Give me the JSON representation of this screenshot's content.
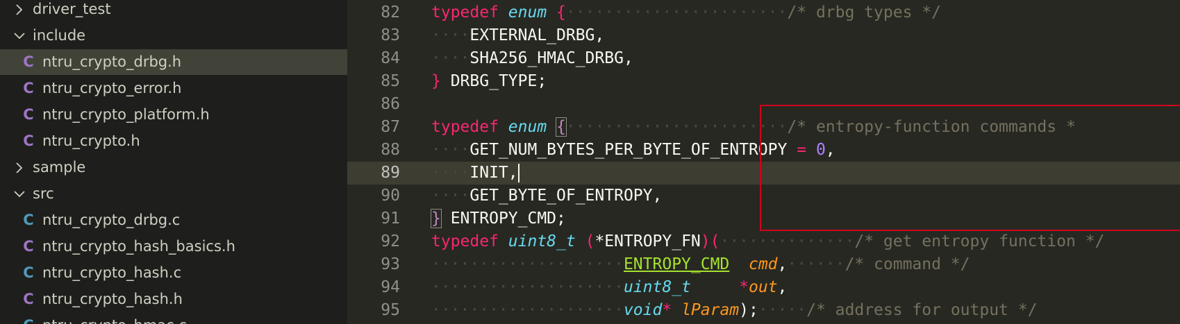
{
  "explorer": {
    "items": [
      {
        "type": "folder",
        "expanded": false,
        "label": "driver_test"
      },
      {
        "type": "folder",
        "expanded": true,
        "label": "include"
      },
      {
        "type": "file",
        "icon": "c-header-icon",
        "icon_char": "C",
        "icon_color": "#a074c4",
        "label": "ntru_crypto_drbg.h",
        "selected": true
      },
      {
        "type": "file",
        "icon": "c-header-icon",
        "icon_char": "C",
        "icon_color": "#a074c4",
        "label": "ntru_crypto_error.h"
      },
      {
        "type": "file",
        "icon": "c-header-icon",
        "icon_char": "C",
        "icon_color": "#a074c4",
        "label": "ntru_crypto_platform.h"
      },
      {
        "type": "file",
        "icon": "c-header-icon",
        "icon_char": "C",
        "icon_color": "#a074c4",
        "label": "ntru_crypto.h"
      },
      {
        "type": "folder",
        "expanded": false,
        "label": "sample"
      },
      {
        "type": "folder",
        "expanded": true,
        "label": "src"
      },
      {
        "type": "file",
        "icon": "c-source-icon",
        "icon_char": "C",
        "icon_color": "#519aba",
        "label": "ntru_crypto_drbg.c"
      },
      {
        "type": "file",
        "icon": "c-header-icon",
        "icon_char": "C",
        "icon_color": "#a074c4",
        "label": "ntru_crypto_hash_basics.h"
      },
      {
        "type": "file",
        "icon": "c-source-icon",
        "icon_char": "C",
        "icon_color": "#519aba",
        "label": "ntru_crypto_hash.c"
      },
      {
        "type": "file",
        "icon": "c-header-icon",
        "icon_char": "C",
        "icon_color": "#a074c4",
        "label": "ntru_crypto_hash.h"
      },
      {
        "type": "file",
        "icon": "c-source-icon",
        "icon_char": "C",
        "icon_color": "#519aba",
        "label": "ntru_crypto_hmac.c"
      }
    ]
  },
  "editor": {
    "current_line": "89",
    "lines": [
      {
        "num": "82",
        "tokens": [
          {
            "t": "typedef",
            "c": "kw"
          },
          {
            "t": " "
          },
          {
            "t": "enum",
            "c": "ty"
          },
          {
            "t": " "
          },
          {
            "t": "{",
            "c": "br1"
          },
          {
            "t": "·······················",
            "c": "ws"
          },
          {
            "t": "/* drbg types */",
            "c": "cm"
          }
        ]
      },
      {
        "num": "83",
        "tokens": [
          {
            "t": "····",
            "c": "ws"
          },
          {
            "t": "EXTERNAL_DRBG,"
          }
        ]
      },
      {
        "num": "84",
        "tokens": [
          {
            "t": "····",
            "c": "ws"
          },
          {
            "t": "SHA256_HMAC_DRBG,"
          }
        ]
      },
      {
        "num": "85",
        "tokens": [
          {
            "t": "}",
            "c": "br1"
          },
          {
            "t": " DRBG_TYPE;"
          }
        ]
      },
      {
        "num": "86",
        "tokens": []
      },
      {
        "num": "87",
        "tokens": [
          {
            "t": "typedef",
            "c": "kw"
          },
          {
            "t": " "
          },
          {
            "t": "enum",
            "c": "ty"
          },
          {
            "t": " "
          },
          {
            "t": "{",
            "c": "br2 bracket-box"
          },
          {
            "t": "·······················",
            "c": "ws"
          },
          {
            "t": "/* entropy-function commands *",
            "c": "cm"
          }
        ]
      },
      {
        "num": "88",
        "tokens": [
          {
            "t": "····",
            "c": "ws"
          },
          {
            "t": "GET_NUM_BYTES_PER_BYTE_OF_ENTROPY"
          },
          {
            "t": " "
          },
          {
            "t": "=",
            "c": "op"
          },
          {
            "t": " "
          },
          {
            "t": "0",
            "c": "num"
          },
          {
            "t": ","
          }
        ]
      },
      {
        "num": "89",
        "tokens": [
          {
            "t": "····",
            "c": "ws"
          },
          {
            "t": "INIT,"
          },
          {
            "t": "",
            "c": "cursor"
          }
        ]
      },
      {
        "num": "90",
        "tokens": [
          {
            "t": "····",
            "c": "ws"
          },
          {
            "t": "GET_BYTE_OF_ENTROPY,"
          }
        ]
      },
      {
        "num": "91",
        "tokens": [
          {
            "t": "}",
            "c": "br2 bracket-box"
          },
          {
            "t": " ENTROPY_CMD;"
          }
        ]
      },
      {
        "num": "92",
        "tokens": [
          {
            "t": "typedef",
            "c": "kw"
          },
          {
            "t": " "
          },
          {
            "t": "uint8_t",
            "c": "ty"
          },
          {
            "t": " "
          },
          {
            "t": "(",
            "c": "br1"
          },
          {
            "t": "*ENTROPY_FN"
          },
          {
            "t": ")(",
            "c": "br1"
          },
          {
            "t": "··············",
            "c": "ws"
          },
          {
            "t": "/* get entropy function */",
            "c": "cm"
          }
        ]
      },
      {
        "num": "93",
        "tokens": [
          {
            "t": "····················",
            "c": "ws"
          },
          {
            "t": "ENTROPY_CMD",
            "c": "ul"
          },
          {
            "t": "  "
          },
          {
            "t": "cmd",
            "c": "pr"
          },
          {
            "t": ","
          },
          {
            "t": "······",
            "c": "ws"
          },
          {
            "t": "/* command */",
            "c": "cm"
          }
        ]
      },
      {
        "num": "94",
        "tokens": [
          {
            "t": "····················",
            "c": "ws"
          },
          {
            "t": "uint8_t",
            "c": "ty"
          },
          {
            "t": "     "
          },
          {
            "t": "*",
            "c": "op"
          },
          {
            "t": "out",
            "c": "pr"
          },
          {
            "t": ","
          }
        ]
      },
      {
        "num": "95",
        "tokens": [
          {
            "t": "····················",
            "c": "ws"
          },
          {
            "t": "void",
            "c": "ty"
          },
          {
            "t": "*",
            "c": "op"
          },
          {
            "t": " "
          },
          {
            "t": "lParam",
            "c": "pr"
          },
          {
            "t": ");"
          },
          {
            "t": "·····",
            "c": "ws"
          },
          {
            "t": "/* address for output */",
            "c": "cm"
          }
        ]
      }
    ]
  }
}
